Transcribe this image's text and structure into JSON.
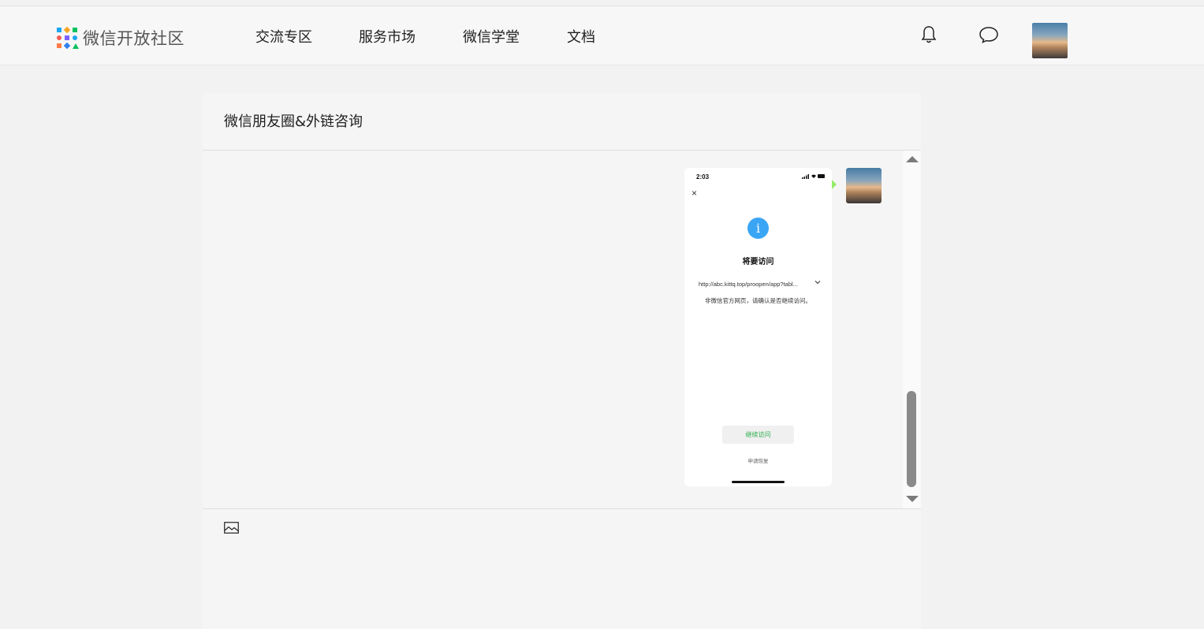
{
  "header": {
    "logo_text": "微信开放社区",
    "nav": [
      {
        "label": "交流专区"
      },
      {
        "label": "服务市场"
      },
      {
        "label": "微信学堂"
      },
      {
        "label": "文档"
      }
    ],
    "icons": [
      "bell-icon",
      "chat-bubble-icon"
    ]
  },
  "panel": {
    "title": "微信朋友圈&外链咨询"
  },
  "message": {
    "phone": {
      "time": "2:03",
      "status_icons": "signal-wifi-battery",
      "close_glyph": "×",
      "info_glyph": "i",
      "heading": "将要访问",
      "url": "http://abc.kittq.top/proopen/app?tabl...",
      "warning": "非微信官方网页，请确认是否继续访问。",
      "continue_label": "继续访问",
      "appeal_label": "申请恢复"
    }
  },
  "composer": {
    "icons": [
      "image-icon"
    ]
  },
  "colors": {
    "accent_green": "#95ec69",
    "continue_text": "#2bae4f",
    "info_blue": "#3ba5f5"
  }
}
